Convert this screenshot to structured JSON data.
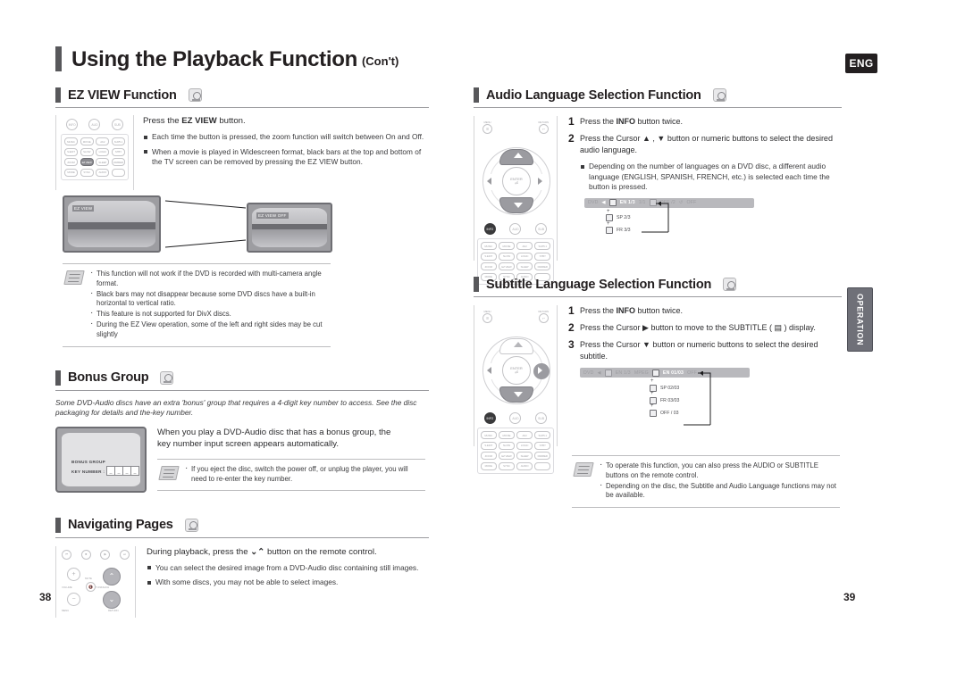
{
  "header": {
    "title_main": "Using the Playback Function",
    "title_sub": "(Con't)",
    "language_badge": "ENG"
  },
  "side_tab": {
    "label": "OPERATION"
  },
  "footer": {
    "page_left": "38",
    "page_right": "39"
  },
  "sections": {
    "ez_view": {
      "title": "EZ VIEW Function",
      "disc_icon": "dvd-audio-disc-icon",
      "lead_prefix": "Press the ",
      "lead_bold": "EZ VIEW",
      "lead_suffix": " button.",
      "bullets": [
        "Each time the button is pressed, the zoom function will switch between On and Off.",
        "When a movie is played in Widescreen format, black bars at the top and bottom of the TV screen can be removed by pressing the EZ VIEW button."
      ],
      "tv_left_caption": "EZ VIEW",
      "tv_right_caption": "EZ VIEW OFF",
      "notes": [
        "This function will not work if the DVD is recorded with multi-camera angle format.",
        "Black bars may not disappear because some DVD discs have a built-in horizontal to vertical ratio.",
        "This feature is not supported for DivX discs.",
        "During the EZ View operation, some of the left and right sides may be cut slightly"
      ]
    },
    "bonus_group": {
      "title": "Bonus Group",
      "disc_icon": "dvd-audio-disc-icon",
      "intro": "Some DVD-Audio discs have an extra 'bonus' group that requires a 4-digit key number to access. See the disc packaging for details and the-key number.",
      "screen_label_1": "BONUS GROUP",
      "screen_label_2": "KEY NUMBER :",
      "key_digits": [
        "_",
        "_",
        "_",
        "_"
      ],
      "lead": "When you play a DVD-Audio disc that has a bonus group, the key number input screen appears automatically.",
      "notes": [
        "If you eject the disc, switch the power off, or unplug the player, you will need to re-enter the key number."
      ]
    },
    "navigating_pages": {
      "title": "Navigating Pages",
      "disc_icon": "dvd-audio-disc-icon",
      "lead_prefix": "During playback, press the ",
      "lead_glyphs": "⌄⌃",
      "lead_suffix": " button on the remote control.",
      "bullets": [
        "You can select the desired image from a DVD-Audio disc containing still images.",
        "With some discs, you may not be able to select images."
      ],
      "remote_labels": {
        "volume": "VOLUME",
        "mute": "MUTE",
        "tuning": "TUNING/CH",
        "menu": "MENU",
        "return": "RETURN",
        "plus": "+",
        "minus": "−"
      }
    },
    "audio_language": {
      "title": "Audio Language Selection Function",
      "disc_icon": "dvd-disc-icon",
      "steps": [
        {
          "n": "1",
          "pre": "Press the ",
          "bold": "INFO",
          "post": " button twice."
        },
        {
          "n": "2",
          "pre": "Press the Cursor ▲ , ▼ button or numeric buttons to select the desired audio language.",
          "bold": "",
          "post": ""
        }
      ],
      "bullets": [
        "Depending on the number of languages on a DVD disc, a different audio language (ENGLISH, SPANISH, FRENCH, etc.) is selected each time the button is pressed."
      ],
      "osd_bar": {
        "prefix": "DVD",
        "arrow": "◀",
        "selected": "EN 1/3",
        "items_dim": [
          "1/1",
          "OFF /2",
          "OFF"
        ]
      },
      "osd_options": [
        "SP 2/3",
        "FR 3/3"
      ]
    },
    "subtitle_language": {
      "title": "Subtitle Language Selection Function",
      "disc_icon": "dvd-disc-icon",
      "steps": [
        {
          "n": "1",
          "pre": "Press the ",
          "bold": "INFO",
          "post": " button twice."
        },
        {
          "n": "2",
          "pre": "Press the Cursor ▶ button to move to the SUBTITLE ( ▤ ) display.",
          "bold": "",
          "post": ""
        },
        {
          "n": "3",
          "pre": "Press the Cursor ▼ button or numeric buttons to select the desired subtitle.",
          "bold": "",
          "post": ""
        }
      ],
      "osd_bar": {
        "prefix": "DVD",
        "arrow": "◀",
        "dim_left": "EN 1/3",
        "dim_left2": "MPEG",
        "selected": "EN 01/03",
        "dim_right": "OFF"
      },
      "osd_options": [
        "SP 02/03",
        "FR 03/03",
        "OFF / 03"
      ],
      "notes": [
        "To operate this function, you can also press the AUDIO or SUBTITLE buttons on the remote control.",
        "Depending on the disc, the Subtitle and Audio Language functions may not be available."
      ]
    }
  },
  "remote_keys": {
    "row_circ": [
      "INFO",
      "AUDIO",
      "SUBTITLE"
    ],
    "grid_rows": [
      [
        "MUSIC",
        "MOVIE",
        "AK2",
        "SUPER 5.1"
      ],
      [
        "SOUND EDIT",
        "SLOW",
        "LOGIC",
        "STANDBY"
      ],
      [
        "ZOOM",
        "EZ VIEW",
        "SLEEP",
        "DIMMER"
      ],
      [
        "MODE",
        "SYNC",
        "AUDIO",
        ""
      ]
    ],
    "dpad": {
      "menu": "MENU",
      "return": "RETURN",
      "enter": "ENTER"
    }
  }
}
